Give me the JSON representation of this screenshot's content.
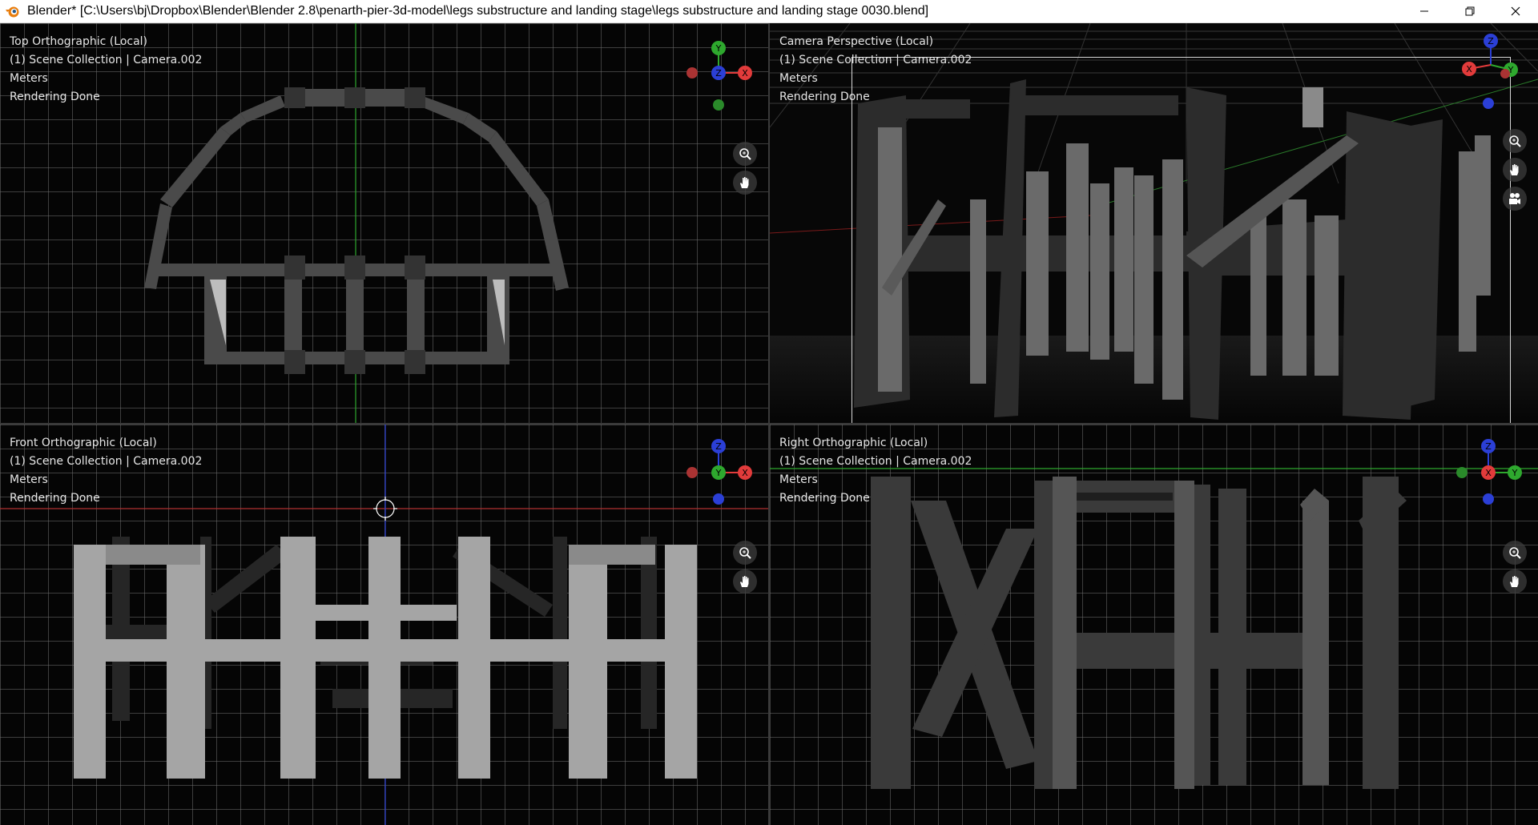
{
  "window": {
    "title": "Blender* [C:\\Users\\bj\\Dropbox\\Blender\\Blender 2.8\\penarth-pier-3d-model\\legs substructure and landing stage\\legs substructure and landing stage 0030.blend]",
    "controls": [
      "minimize",
      "restore",
      "close"
    ]
  },
  "viewports": {
    "top_left": {
      "view_name": "Top Orthographic (Local)",
      "collection": "(1) Scene Collection | Camera.002",
      "units": "Meters",
      "status": "Rendering Done",
      "gizmo_axes": [
        "Y",
        "X",
        "Z"
      ]
    },
    "top_right": {
      "view_name": "Camera Perspective (Local)",
      "collection": "(1) Scene Collection | Camera.002",
      "units": "Meters",
      "status": "Rendering Done",
      "gizmo_axes": [
        "Z",
        "X",
        "Y"
      ]
    },
    "bottom_left": {
      "view_name": "Front Orthographic (Local)",
      "collection": "(1) Scene Collection | Camera.002",
      "units": "Meters",
      "status": "Rendering Done",
      "gizmo_axes": [
        "Z",
        "Y",
        "X"
      ]
    },
    "bottom_right": {
      "view_name": "Right Orthographic (Local)",
      "collection": "(1) Scene Collection | Camera.002",
      "units": "Meters",
      "status": "Rendering Done",
      "gizmo_axes": [
        "Z",
        "X",
        "Y"
      ]
    }
  },
  "colors": {
    "x_axis": "#e23b3b",
    "y_axis": "#2ea82e",
    "z_axis": "#2b3fd6",
    "grid": "#6e6e6e",
    "background": "#050505"
  },
  "icons": [
    "blender-logo-icon",
    "zoom-icon",
    "pan-hand-icon",
    "camera-icon"
  ]
}
